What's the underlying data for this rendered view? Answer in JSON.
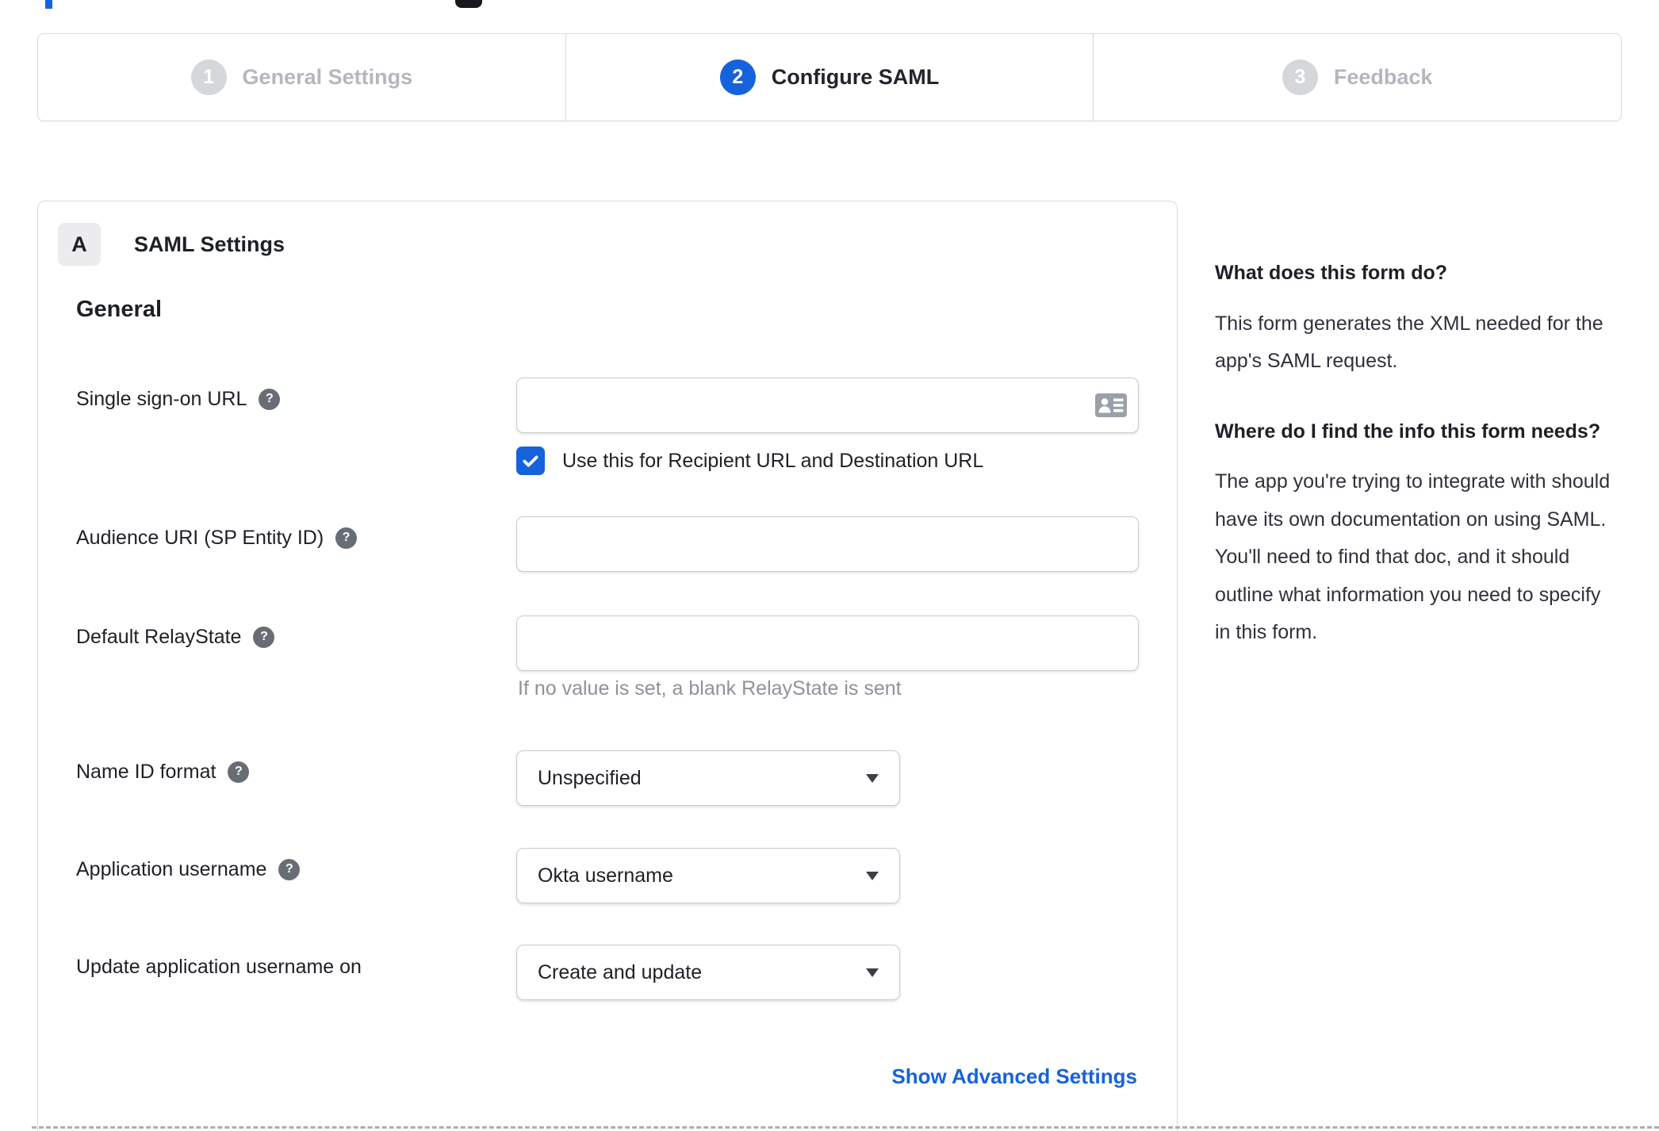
{
  "colors": {
    "accent_blue": "#1662dd",
    "inactive_gray": "#d5d7db",
    "border_gray": "#d6d9dd",
    "hint_gray": "#8d929b"
  },
  "stepper": {
    "steps": [
      {
        "number": "1",
        "label": "General Settings",
        "state": "inactive"
      },
      {
        "number": "2",
        "label": "Configure SAML",
        "state": "active"
      },
      {
        "number": "3",
        "label": "Feedback",
        "state": "inactive"
      }
    ]
  },
  "form_card": {
    "section_badge": "A",
    "section_title": "SAML Settings",
    "group_title": "General",
    "fields": [
      {
        "label": "Single sign-on URL",
        "value": "",
        "trailing_icon": "contact-card-icon",
        "checkbox": {
          "checked": true,
          "label": "Use this for Recipient URL and Destination URL"
        }
      },
      {
        "label": "Audience URI (SP Entity ID)",
        "value": ""
      },
      {
        "label": "Default RelayState",
        "value": "",
        "hint": "If no value is set, a blank RelayState is sent"
      },
      {
        "label": "Name ID format",
        "value": "Unspecified"
      },
      {
        "label": "Application username",
        "value": "Okta username"
      },
      {
        "label": "Update application username on",
        "value": "Create and update"
      }
    ],
    "show_advanced_label": "Show Advanced Settings"
  },
  "sidebar": {
    "section1": {
      "title": "What does this form do?",
      "body": "This form generates the XML needed for the app's SAML request."
    },
    "section2": {
      "title": "Where do I find the info this form needs?",
      "body": "The app you're trying to integrate with should have its own documentation on using SAML. You'll need to find that doc, and it should outline what information you need to specify in this form."
    }
  }
}
